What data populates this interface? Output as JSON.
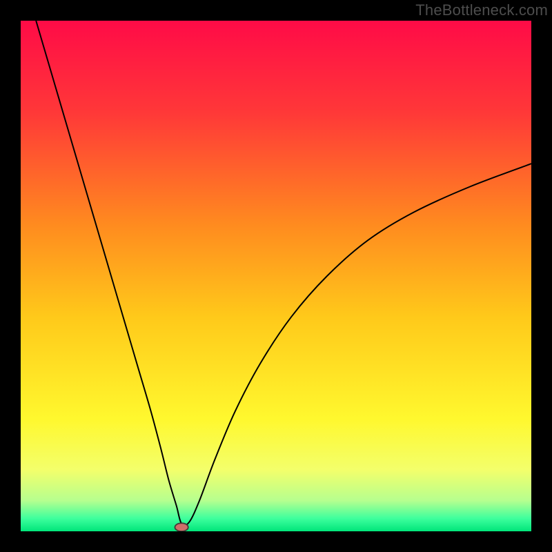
{
  "watermark": "TheBottleneck.com",
  "chart_data": {
    "type": "line",
    "title": "",
    "xlabel": "",
    "ylabel": "",
    "xlim": [
      0,
      100
    ],
    "ylim": [
      0,
      100
    ],
    "grid": false,
    "legend": false,
    "background_gradient_stops": [
      {
        "offset": 0.0,
        "color": "#ff0b47"
      },
      {
        "offset": 0.18,
        "color": "#ff3838"
      },
      {
        "offset": 0.4,
        "color": "#ff8b1f"
      },
      {
        "offset": 0.58,
        "color": "#ffc91a"
      },
      {
        "offset": 0.78,
        "color": "#fff82e"
      },
      {
        "offset": 0.88,
        "color": "#f3ff6b"
      },
      {
        "offset": 0.94,
        "color": "#b6ff8f"
      },
      {
        "offset": 0.975,
        "color": "#3dff9d"
      },
      {
        "offset": 1.0,
        "color": "#00e57a"
      }
    ],
    "curve": {
      "description": "Black curve: steep left descent to optimum dip, then asymptotic rise toward ~72%",
      "stroke": "#000000",
      "stroke_width": 2.0,
      "x": [
        3,
        5.5,
        8,
        10.5,
        13,
        15.5,
        18,
        20.5,
        23,
        25.5,
        27.5,
        29,
        30.5,
        31.5,
        33,
        35,
        38,
        42,
        47,
        53,
        60,
        68,
        77,
        88,
        100
      ],
      "y": [
        100,
        91.5,
        83,
        74.5,
        66,
        57.5,
        49,
        40.5,
        32,
        23.5,
        16,
        10,
        5,
        1.5,
        1.8,
        6,
        14,
        23.5,
        33,
        42,
        50,
        57,
        62.5,
        67.5,
        72
      ]
    },
    "optimum_marker": {
      "x": 31.5,
      "y": 0.8,
      "rx": 1.3,
      "ry": 0.8,
      "fill": "#cf6e69",
      "stroke": "#463a38"
    }
  }
}
